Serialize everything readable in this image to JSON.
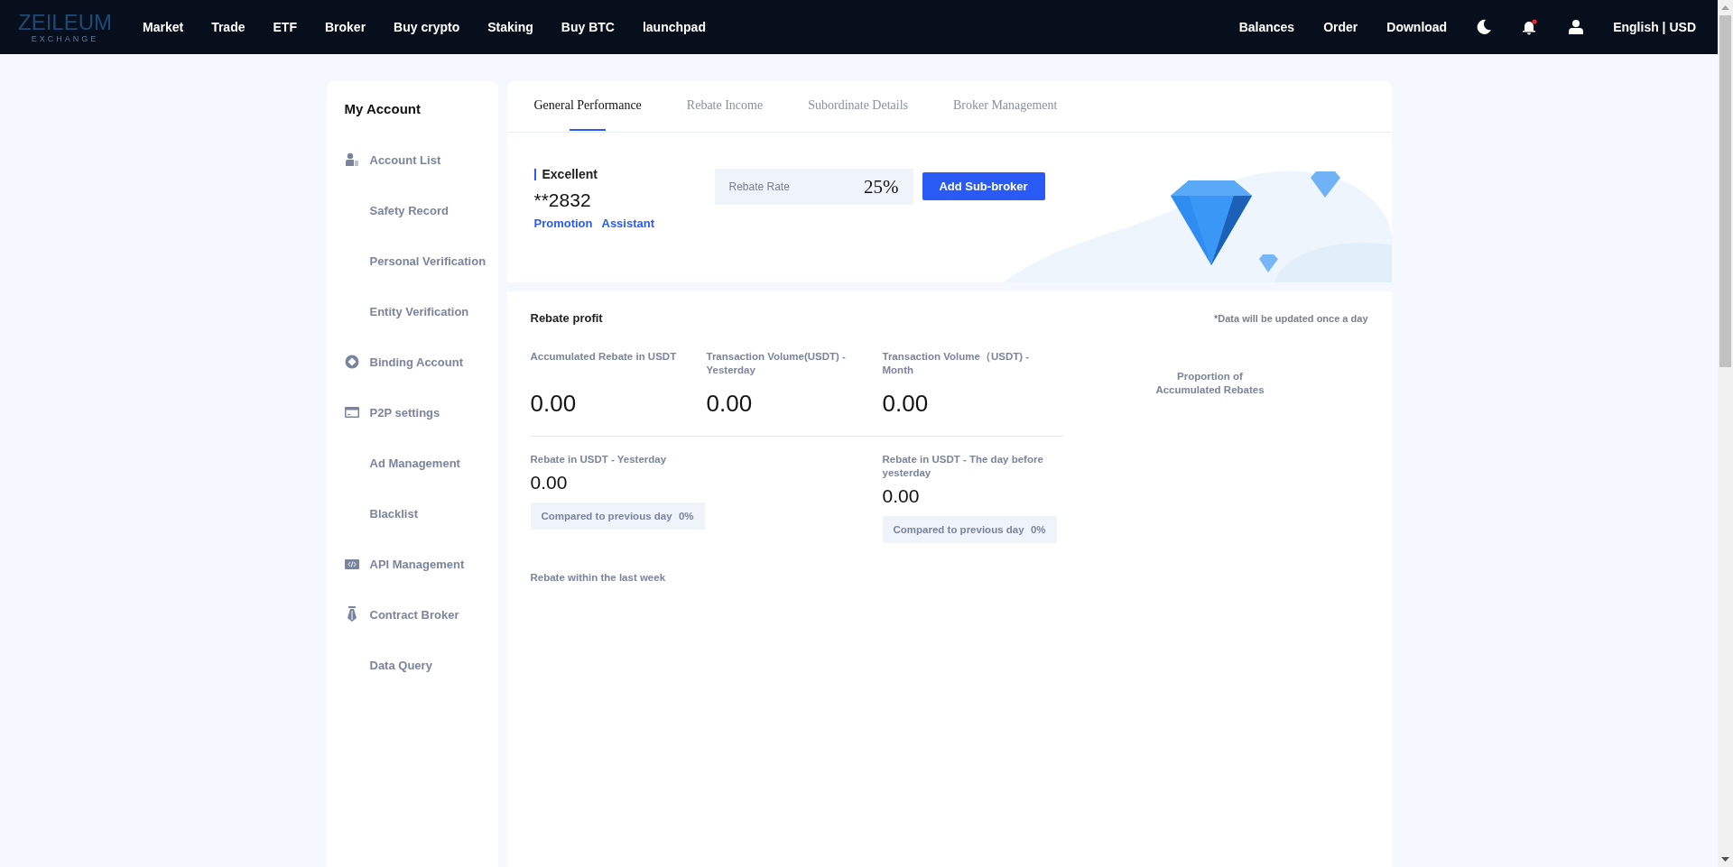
{
  "logo": {
    "name": "ZEILEUM",
    "tagline": "EXCHANGE"
  },
  "nav": [
    "Market",
    "Trade",
    "ETF",
    "Broker",
    "Buy crypto",
    "Staking",
    "Buy BTC",
    "launchpad"
  ],
  "nav_right": [
    "Balances",
    "Order",
    "Download"
  ],
  "notifications": {
    "unread": true
  },
  "language": "English | USD",
  "sidebar": {
    "title": "My Account",
    "items": [
      {
        "label": "Account List",
        "kind": "section"
      },
      {
        "label": "Safety Record",
        "kind": "link"
      },
      {
        "label": "Personal Verification",
        "kind": "link"
      },
      {
        "label": "Entity Verification",
        "kind": "link"
      },
      {
        "label": "Binding Account",
        "kind": "section"
      },
      {
        "label": "P2P settings",
        "kind": "section"
      },
      {
        "label": "Ad Management",
        "kind": "link"
      },
      {
        "label": "Blacklist",
        "kind": "link"
      },
      {
        "label": "API Management",
        "kind": "section"
      },
      {
        "label": "Contract Broker",
        "kind": "section"
      },
      {
        "label": "Data Query",
        "kind": "link"
      }
    ]
  },
  "tabs": [
    {
      "label": "General Performance",
      "selected": true
    },
    {
      "label": "Rebate Income",
      "selected": false
    },
    {
      "label": "Subordinate Details",
      "selected": false
    },
    {
      "label": "Broker Management",
      "selected": false
    }
  ],
  "summary": {
    "level": "Excellent",
    "account": "**2832",
    "links": [
      "Promotion",
      "Assistant"
    ],
    "rate_label": "Rebate Rate",
    "rate_value": "25%",
    "button": "Add Sub-broker"
  },
  "rebate_profit": {
    "title": "Rebate profit",
    "note": "*Data will be updated once a day",
    "stats": [
      {
        "label": "Accumulated Rebate in USDT",
        "value": "0.00"
      },
      {
        "label": "Transaction Volume(USDT) - Yesterday",
        "value": "0.00"
      },
      {
        "label": "Transaction Volume（USDT) - Month",
        "value": "0.00"
      }
    ],
    "daily": [
      {
        "label": "Rebate in USDT - Yesterday",
        "value": "0.00",
        "compare_label": "Compared to previous day",
        "compare_value": "0%"
      },
      {
        "label": "Rebate in USDT - The day before yesterday",
        "value": "0.00",
        "compare_label": "Compared to previous day",
        "compare_value": "0%"
      }
    ],
    "week_title": "Rebate within the last week",
    "proportion_title": "Proportion of Accumulated Rebates"
  }
}
